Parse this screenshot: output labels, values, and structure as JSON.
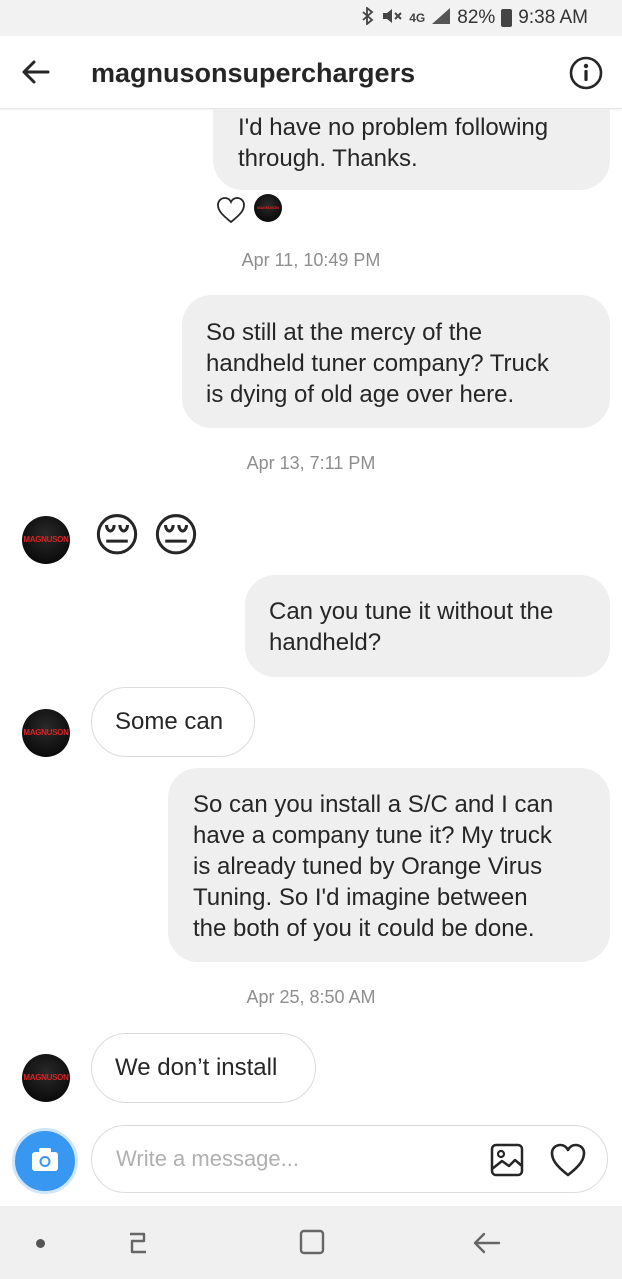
{
  "status_bar": {
    "icons": [
      "bluetooth-icon",
      "mute-icon",
      "4g-lte-icon",
      "signal-icon",
      "battery-icon"
    ],
    "network": "4G",
    "battery": "82%",
    "time": "9:38 AM"
  },
  "header": {
    "title": "magnusonsuperchargers",
    "back_icon": "arrow-left-icon",
    "info_icon": "info-icon"
  },
  "avatar": {
    "brand_text": "MAGNUSON"
  },
  "messages": {
    "m1": {
      "text": "I'd have no problem following\nthrough. Thanks."
    },
    "ts1": "Apr 11, 10:49 PM",
    "m2": {
      "text": "So still at the mercy of the\nhandheld tuner company? Truck\nis dying of old age over here."
    },
    "ts2": "Apr 13, 7:11 PM",
    "m3": {
      "emoji": "😔",
      "emoji2": "😔"
    },
    "m4": {
      "text": "Can you tune it without the\nhandheld?"
    },
    "m5": {
      "text": "Some can"
    },
    "m6": {
      "text": "So can you install a S/C and I can\nhave a company tune it? My truck\nis already tuned by Orange Virus\nTuning. So I'd imagine between\nthe both of you it could be done."
    },
    "ts3": "Apr 25, 8:50 AM",
    "m7": {
      "text": "We don’t install"
    }
  },
  "composer": {
    "placeholder": "Write a message...",
    "camera_icon": "camera-icon",
    "gallery_icon": "image-icon",
    "like_icon": "heart-icon"
  },
  "colors": {
    "accent": "#3897f0",
    "outgoing_bubble": "#efefef",
    "incoming_border": "#dbdbdb",
    "timestamp": "#8e8e8e"
  }
}
